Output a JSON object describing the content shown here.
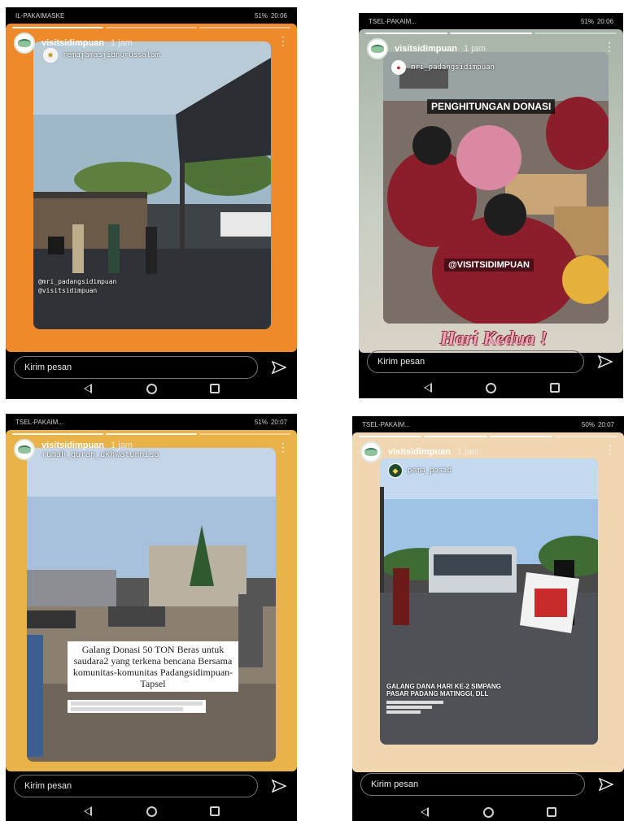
{
  "screens": [
    {
      "status": {
        "carrier": "IL-PAKAIMASKE",
        "battery": "51%",
        "time": "20:06"
      },
      "header": {
        "username": "visitsidimpuan",
        "time_ago": "1 jam"
      },
      "repost": {
        "account": "remajamasjidnurussalam"
      },
      "mentions": [
        "@mri_padangsidimpuan",
        "@visitsidimpuan"
      ],
      "message_placeholder": "Kirim pesan",
      "colors": {
        "background": "#ef8a2c"
      }
    },
    {
      "status": {
        "carrier": "TSEL-PAKAIM...",
        "battery": "51%",
        "time": "20:06"
      },
      "header": {
        "username": "visitsidimpuan",
        "time_ago": "1 jam"
      },
      "repost": {
        "account": "mri_padangsidimpuan"
      },
      "labels": {
        "top": "PENGHITUNGAN DONASI",
        "mention": "@VISITSIDIMPUAN",
        "sticker": "Hari Kedua !"
      },
      "message_placeholder": "Kirim pesan",
      "colors": {
        "background": "#c9cfc4"
      }
    },
    {
      "status": {
        "carrier": "TSEL-PAKAIM...",
        "battery": "51%",
        "time": "20:07"
      },
      "header": {
        "username": "visitsidimpuan",
        "time_ago": "1 jam"
      },
      "repost": {
        "account": "rumah_quran_ukhwatunnisa"
      },
      "caption": "Galang Donasi 50 TON Beras untuk saudara2 yang terkena bencana Bersama komunitas-komunitas Padangsidimpuan-Tapsel",
      "message_placeholder": "Kirim pesan",
      "colors": {
        "background": "#e9b34a"
      }
    },
    {
      "status": {
        "carrier": "TSEL-PAKAIM...",
        "battery": "50%",
        "time": "20:07"
      },
      "header": {
        "username": "visitsidimpuan",
        "time_ago": "1 jam"
      },
      "repost": {
        "account": "pema_pasid"
      },
      "caption": "GALANG DANA HARI KE-2 SIMPANG PASAR PADANG MATINGGI, DLL",
      "message_placeholder": "Kirim pesan",
      "colors": {
        "background": "#f0d7b2"
      }
    }
  ]
}
